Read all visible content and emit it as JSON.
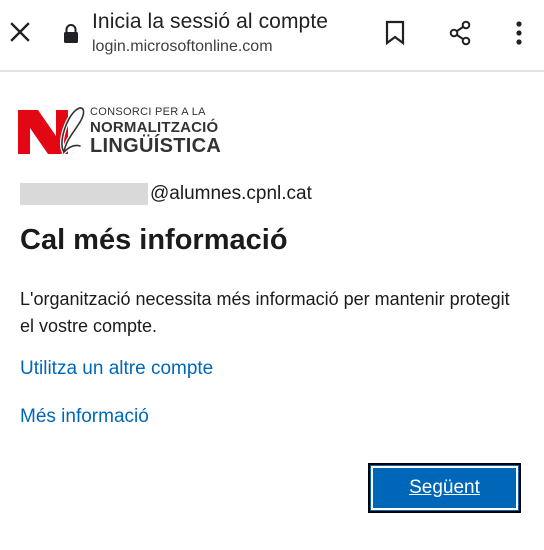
{
  "browser": {
    "title": "Inicia la sessió al compte",
    "url": "login.microsoftonline.com",
    "icons": {
      "close": "close-icon",
      "lock": "lock-icon",
      "bookmark": "bookmark-icon",
      "share": "share-icon",
      "menu": "more-vert-icon"
    }
  },
  "logo": {
    "line1": "CONSORCI PER A LA",
    "line2": "NORMALITZACIÓ",
    "line3": "LINGÜÍSTICA",
    "colors": {
      "red": "#e30613",
      "text": "#333333"
    }
  },
  "account": {
    "email_domain": "@alumnes.cpnl.cat"
  },
  "main": {
    "heading": "Cal més informació",
    "description": "L'organització necessita més informació per mantenir protegit el vostre compte.",
    "link_other_account": "Utilitza un altre compte",
    "link_more_info": "Més informació",
    "next_button": "Següent"
  },
  "colors": {
    "link": "#0067b8",
    "button_bg": "#0067b8",
    "text": "#1b1b1b",
    "redaction": "#d9d9d9"
  }
}
